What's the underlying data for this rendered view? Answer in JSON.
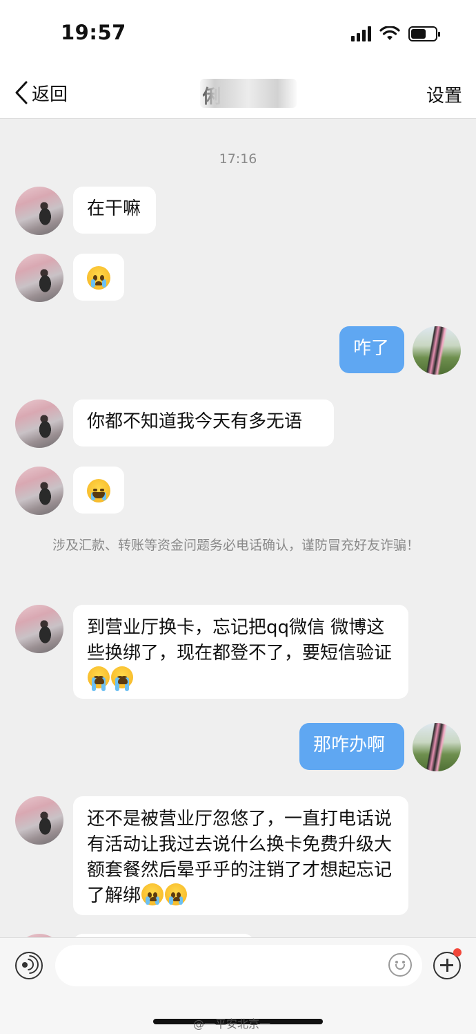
{
  "status_bar": {
    "time": "19:57",
    "icons": [
      "cellular-signal-icon",
      "wifi-icon",
      "battery-icon"
    ]
  },
  "nav": {
    "back_label": "返回",
    "title": "俐",
    "settings_label": "设置"
  },
  "chat": {
    "timestamp": "17:16",
    "notice": "涉及汇款、转账等资金问题务必电话确认，谨防冒充好友诈骗！",
    "messages": [
      {
        "side": "in",
        "text": "在干嘛"
      },
      {
        "side": "in",
        "emoji": "crying-face-emoji"
      },
      {
        "side": "out",
        "text": "咋了"
      },
      {
        "side": "in",
        "text": "你都不知道我今天有多无语"
      },
      {
        "side": "in",
        "emoji": "laughing-crying-face-emoji"
      },
      {
        "side": "in",
        "text": "到营业厅换卡，忘记把qq微信 微博这些换绑了，现在都登不了，要短信验证",
        "emojis_after": 2
      },
      {
        "side": "out",
        "text": "那咋办啊"
      },
      {
        "side": "in",
        "text": "还不是被营业厅忽悠了，一直打电话说有活动让我过去说什么换卡免费升级大额套餐然后晕乎乎的注销了才想起忘记了解绑",
        "emojis_after": 2
      }
    ],
    "colors": {
      "background": "#efefef",
      "incoming_bubble": "#ffffff",
      "outgoing_bubble": "#5fa7f2"
    }
  },
  "input_bar": {
    "placeholder": "",
    "icons": [
      "voice-icon",
      "emoji-icon",
      "plus-icon"
    ]
  },
  "watermark": "@一平安北京一"
}
